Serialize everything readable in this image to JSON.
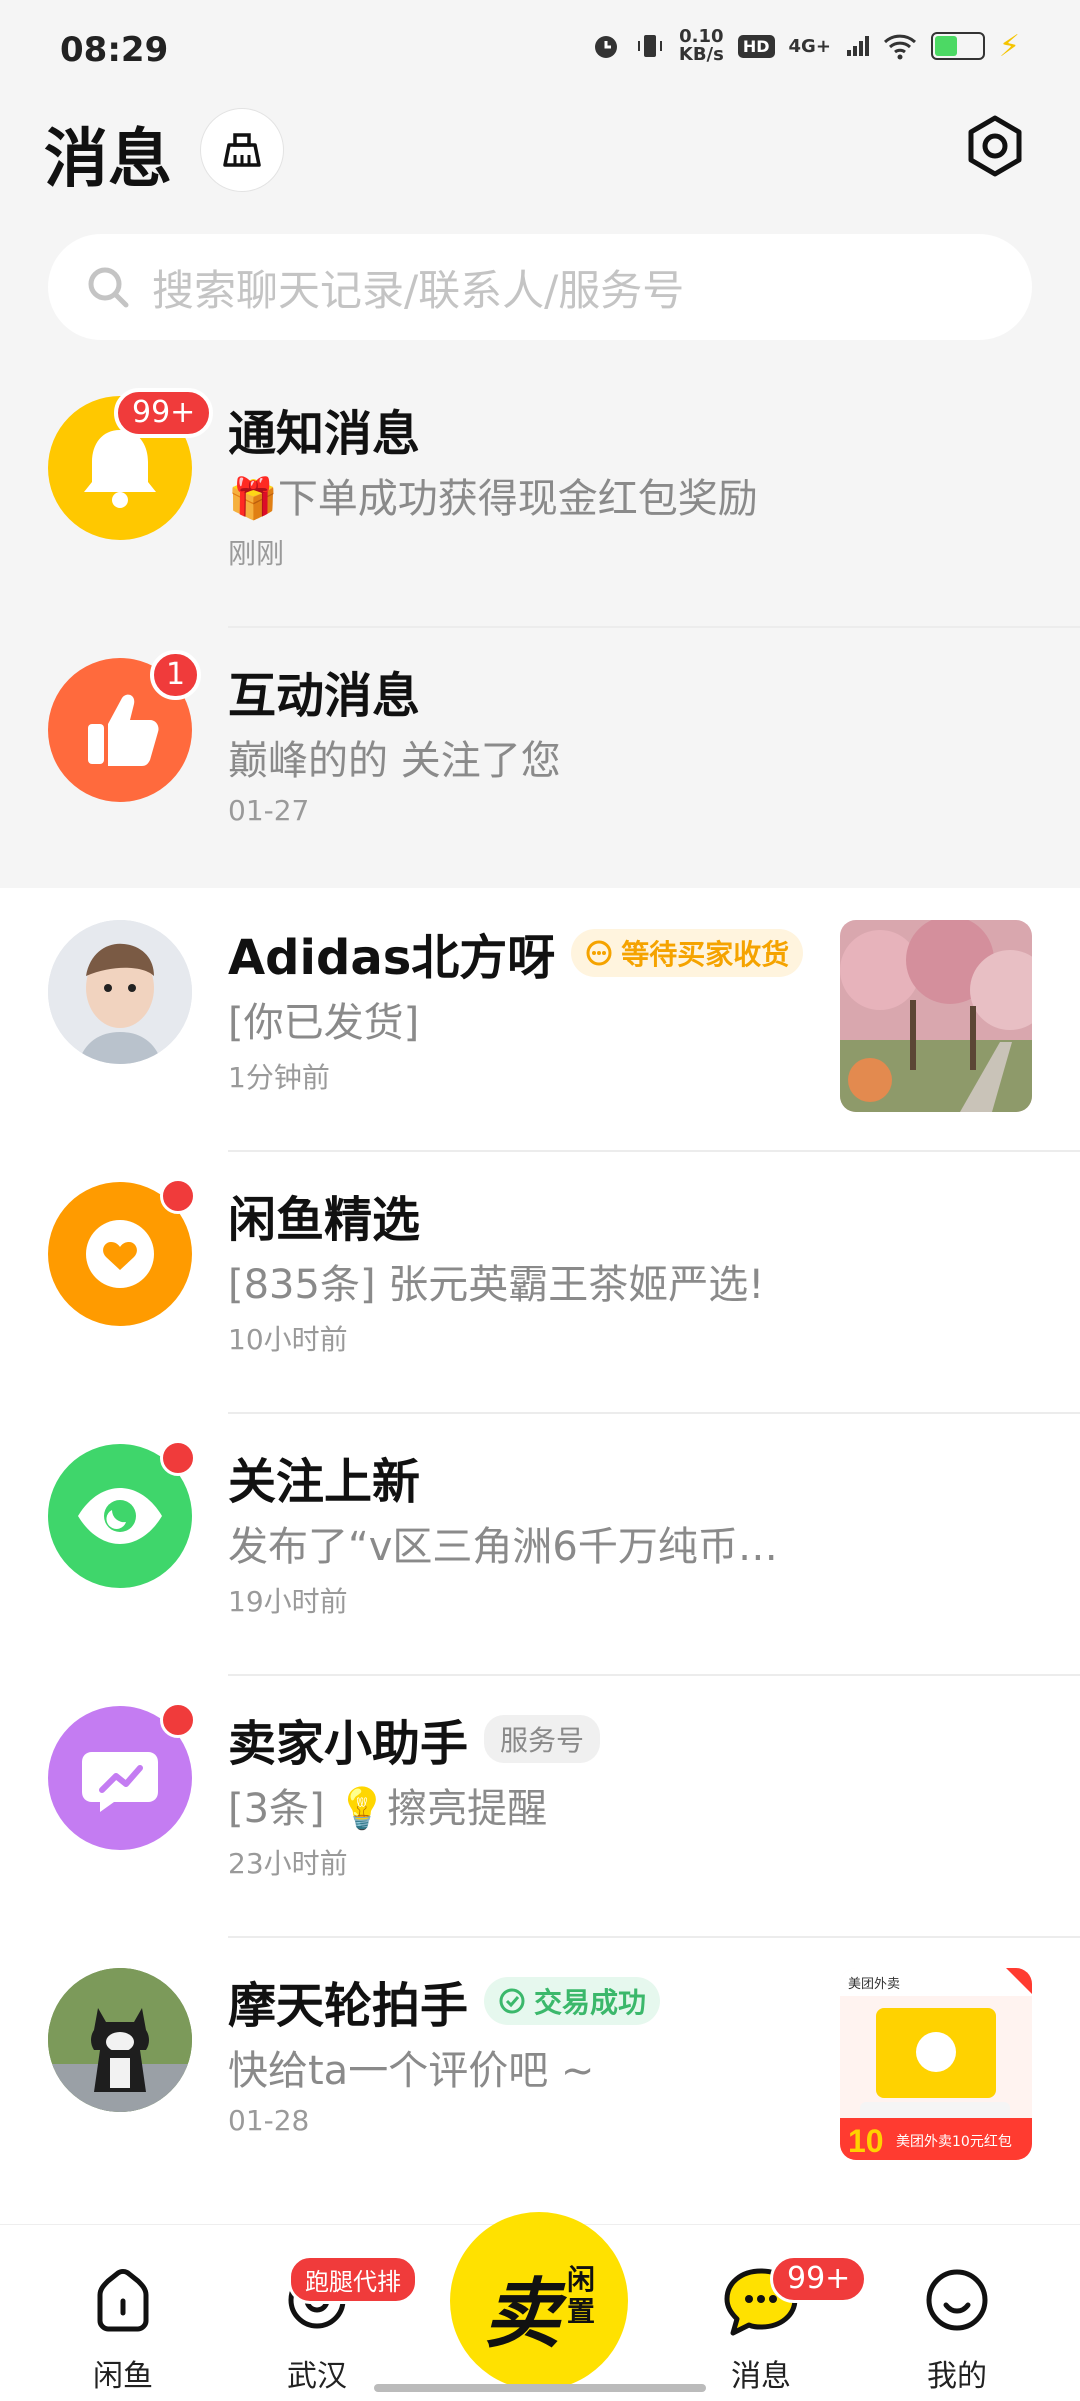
{
  "status_bar": {
    "time": "08:29",
    "speed_value": "0.10",
    "speed_unit": "KB/s",
    "hd": "HD",
    "network": "4G+",
    "icons": [
      "alarm-icon",
      "vibrate-icon",
      "signal-icon",
      "wifi-icon",
      "battery-icon",
      "charging-icon"
    ]
  },
  "header": {
    "title": "消息"
  },
  "search": {
    "placeholder": "搜索聊天记录/联系人/服务号"
  },
  "conversations": [
    {
      "title": "通知消息",
      "message": "下单成功获得现金红包奖励",
      "message_icon": "gift-icon",
      "time": "刚刚",
      "badge": "99+"
    },
    {
      "title": "互动消息",
      "message": "巅峰的的 关注了您",
      "time": "01-27",
      "badge": "1"
    },
    {
      "title": "Adidas北方呀",
      "tag": "等待买家收货",
      "message": "[你已发货]",
      "time": "1分钟前"
    },
    {
      "title": "闲鱼精选",
      "message": "[835条] 张元英霸王茶姬严选!",
      "time": "10小时前"
    },
    {
      "title": "关注上新",
      "message": "发布了“v区三角洲6千万纯币…",
      "time": "19小时前"
    },
    {
      "title": "卖家小助手",
      "tag": "服务号",
      "message": "[3条] 💡擦亮提醒",
      "time": "23小时前"
    },
    {
      "title": "摩天轮拍手",
      "tag": "交易成功",
      "message": "快给ta一个评价吧 ~",
      "time": "01-28"
    }
  ],
  "thumb_texts": {
    "brand": "美团外卖",
    "big_num": "10",
    "caption": "美团外卖10元红包"
  },
  "tab_bar": {
    "tabs": [
      {
        "label": "闲鱼"
      },
      {
        "label": "武汉",
        "badge": "跑腿代排"
      },
      {
        "label": "消息",
        "badge": "99+"
      },
      {
        "label": "我的"
      }
    ],
    "sell_main": "卖",
    "sell_sub": "闲置"
  },
  "colors": {
    "brand_yellow": "#ffe100",
    "badge_red": "#f03b3b",
    "notify_bg": "#ffc800",
    "interact_bg": "#ff6a3d",
    "xianyu_pick_bg": "#ff9b00",
    "follow_bg": "#3fd66b",
    "assistant_bg": "#c47cf2"
  }
}
